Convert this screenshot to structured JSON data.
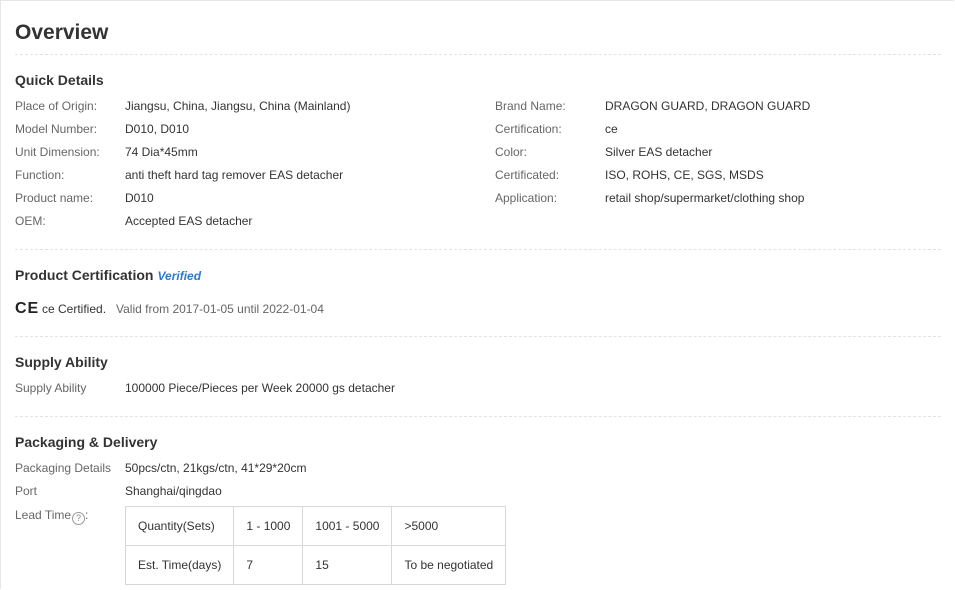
{
  "overview_title": "Overview",
  "quick_details": {
    "heading": "Quick Details",
    "left": [
      {
        "label": "Place of Origin:",
        "value": "Jiangsu, China, Jiangsu, China (Mainland)"
      },
      {
        "label": "Model Number:",
        "value": "D010, D010"
      },
      {
        "label": "Unit Dimension:",
        "value": "74 Dia*45mm"
      },
      {
        "label": "Function:",
        "value": "anti theft hard tag remover EAS detacher"
      },
      {
        "label": "Product name:",
        "value": "D010"
      },
      {
        "label": "OEM:",
        "value": "Accepted EAS detacher"
      }
    ],
    "right": [
      {
        "label": "Brand Name:",
        "value": "DRAGON GUARD, DRAGON GUARD"
      },
      {
        "label": "Certification:",
        "value": "ce"
      },
      {
        "label": "Color:",
        "value": "Silver EAS detacher"
      },
      {
        "label": "Certificated:",
        "value": "ISO, ROHS, CE, SGS, MSDS"
      },
      {
        "label": "Application:",
        "value": "retail shop/supermarket/clothing shop"
      }
    ]
  },
  "product_certification": {
    "heading": "Product Certification",
    "verified_label": "Verified",
    "mark": "CE",
    "cert_name": "ce Certified.",
    "validity": "Valid from 2017-01-05 until 2022-01-04"
  },
  "supply_ability": {
    "heading": "Supply Ability",
    "label": "Supply Ability",
    "value": "100000 Piece/Pieces per Week 20000 gs detacher"
  },
  "packaging_delivery": {
    "heading": "Packaging & Delivery",
    "packaging_label": "Packaging Details",
    "packaging_value": "50pcs/ctn, 21kgs/ctn, 41*29*20cm",
    "port_label": "Port",
    "port_value": "Shanghai/qingdao",
    "lead_time_label": "Lead Time",
    "lead_time_suffix": ":",
    "help_icon_glyph": "?",
    "lead_table": {
      "rows": [
        [
          "Quantity(Sets)",
          "1 - 1000",
          "1001 - 5000",
          ">5000"
        ],
        [
          "Est. Time(days)",
          "7",
          "15",
          "To be negotiated"
        ]
      ]
    }
  }
}
